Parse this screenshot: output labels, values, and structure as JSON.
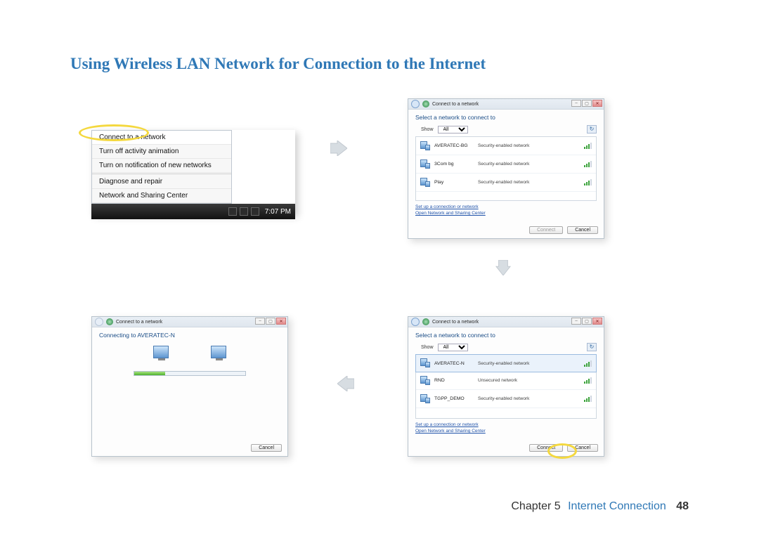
{
  "page": {
    "title": "Using Wireless LAN Network for Connection to the Internet",
    "chapter_label": "Chapter 5",
    "chapter_name": "Internet Connection",
    "page_number": "48"
  },
  "menu": {
    "items": [
      "Connect to a network",
      "Turn off activity animation",
      "Turn on notification of new networks",
      "Diagnose and repair",
      "Network and Sharing Center"
    ],
    "clock": "7:07 PM"
  },
  "common": {
    "window_title": "Connect to a network",
    "select_heading": "Select a network to connect to",
    "show_label": "Show",
    "show_value": "All",
    "link1": "Set up a connection or network",
    "link2": "Open Network and Sharing Center",
    "btn_connect": "Connect",
    "btn_cancel": "Cancel"
  },
  "win2": {
    "networks": [
      {
        "name": "AVERATEC-BG",
        "sec": "Security-enabled network"
      },
      {
        "name": "3Com bg",
        "sec": "Security-enabled network"
      },
      {
        "name": "Play",
        "sec": "Security-enabled network"
      }
    ]
  },
  "win3": {
    "status": "Connecting to AVERATEC-N"
  },
  "win4": {
    "networks": [
      {
        "name": "AVERATEC-N",
        "sec": "Security-enabled network"
      },
      {
        "name": "RND",
        "sec": "Unsecured network"
      },
      {
        "name": "TGPP_DEMO",
        "sec": "Security-enabled network"
      }
    ]
  }
}
